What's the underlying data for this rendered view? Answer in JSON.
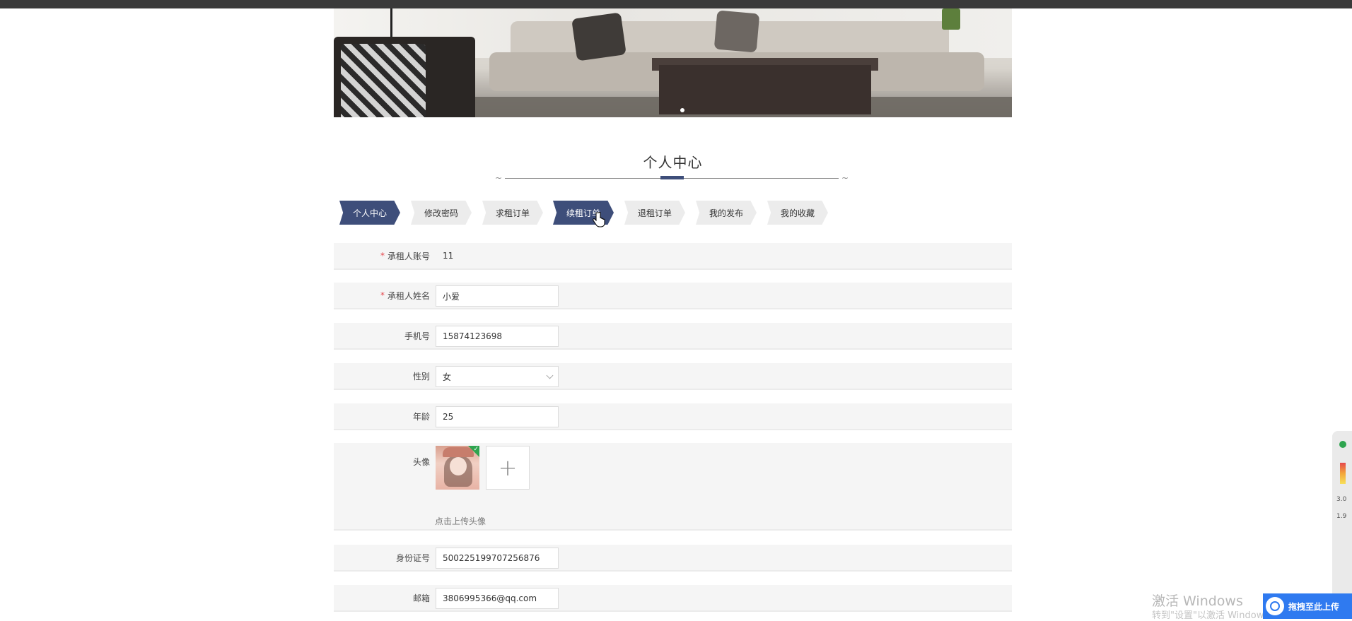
{
  "banner": {
    "name": "banner-image"
  },
  "section": {
    "title": "个人中心"
  },
  "tabs": [
    {
      "label": "个人中心",
      "active": true
    },
    {
      "label": "修改密码",
      "active": false
    },
    {
      "label": "求租订单",
      "active": false
    },
    {
      "label": "续租订单",
      "active": false
    },
    {
      "label": "退租订单",
      "active": false
    },
    {
      "label": "我的发布",
      "active": false
    },
    {
      "label": "我的收藏",
      "active": false
    }
  ],
  "form": {
    "account": {
      "required_mark": "*",
      "label": "承租人账号",
      "value": "11"
    },
    "name": {
      "required_mark": "*",
      "label": "承租人姓名",
      "value": "小爱"
    },
    "phone": {
      "label": "手机号",
      "value": "15874123698"
    },
    "gender": {
      "label": "性别",
      "value": "女"
    },
    "age": {
      "label": "年龄",
      "value": "25"
    },
    "avatar": {
      "label": "头像",
      "hint": "点击上传头像",
      "upload_icon": "+"
    },
    "id_number": {
      "label": "身份证号",
      "value": "500225199707256876"
    },
    "email": {
      "label": "邮箱",
      "value": "3806995366@qq.com"
    }
  },
  "overlay": {
    "watermark_line1": "激活 Windows",
    "watermark_line2": "转到\"设置\"以激活 Windows。",
    "upload_float_label": "拖拽至此上传",
    "side_values": [
      "3.0",
      "1.9"
    ]
  },
  "colors": {
    "accent": "#3e4e7a",
    "required": "#e5484d",
    "row_bg": "#f5f5f5"
  }
}
